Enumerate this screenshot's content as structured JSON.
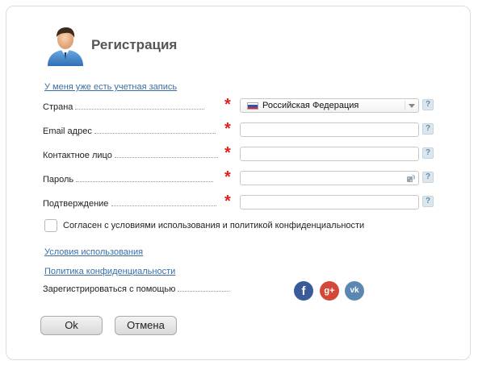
{
  "header": {
    "title": "Регистрация"
  },
  "links": {
    "have_account": "У меня уже есть учетная запись",
    "terms": "Условия использования",
    "privacy": "Политика конфиденциальности"
  },
  "form": {
    "required_mark": "*",
    "help_mark": "?",
    "fields": [
      {
        "label": "Страна",
        "type": "select",
        "value": "Российская Федерация"
      },
      {
        "label": "Email адрес",
        "type": "text",
        "value": ""
      },
      {
        "label": "Контактное лицо",
        "type": "text",
        "value": ""
      },
      {
        "label": "Пароль",
        "type": "password",
        "value": ""
      },
      {
        "label": "Подтверждение",
        "type": "password",
        "value": ""
      }
    ],
    "agree_label": "Согласен с условиями использования и политикой конфиденциальности",
    "agree_checked": false
  },
  "social": {
    "label": "Зарегистрироваться с помощью",
    "buttons": [
      {
        "icon": "facebook-icon",
        "glyph": "f",
        "color": "#3b5a9a"
      },
      {
        "icon": "google-plus-icon",
        "glyph": "g+",
        "color": "#d34836"
      },
      {
        "icon": "vk-icon",
        "glyph": "vk",
        "color": "#5b88b0"
      }
    ]
  },
  "buttons": {
    "ok": "Ok",
    "cancel": "Отмена"
  }
}
